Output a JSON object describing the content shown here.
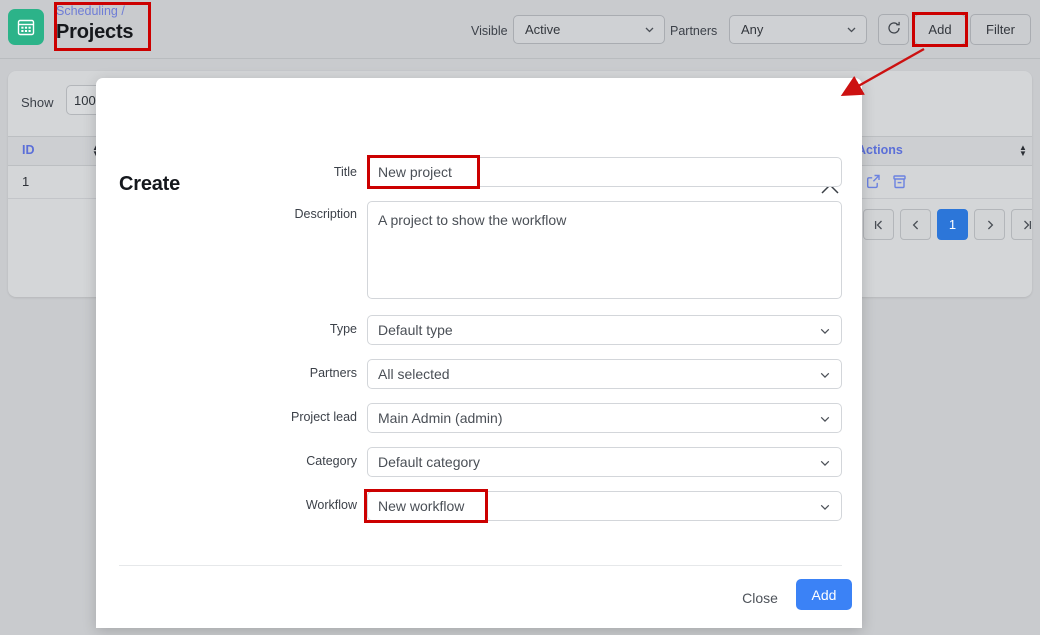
{
  "app": {
    "icon": "calendar-icon",
    "accent_green": "#2cb389",
    "accent_blue": "#3b82f6",
    "highlight_red": "#cc0000"
  },
  "header": {
    "breadcrumb": "Scheduling /",
    "title": "Projects"
  },
  "toolbar": {
    "visible_label": "Visible",
    "visible_value": "Active",
    "partners_label": "Partners",
    "partners_value": "Any",
    "refresh_icon": "refresh-icon",
    "add_label": "Add",
    "filter_label": "Filter"
  },
  "table": {
    "show_label": "Show",
    "show_value": "100",
    "search_placeholder": "",
    "search_value": "",
    "search_icon": "search-icon",
    "more_icon": "ellipsis-icon",
    "expand_icon": "collapse-arrow-icon",
    "columns": [
      {
        "label": "ID",
        "sortable": "true"
      },
      {
        "label": "Actions",
        "sortable": "true"
      }
    ],
    "rows": [
      {
        "id": "1",
        "actions": [
          "open-external-icon",
          "archive-icon"
        ]
      }
    ],
    "pagination": {
      "first": "|<",
      "prev": "<",
      "current": "1",
      "next": ">",
      "last": ">|"
    }
  },
  "modal": {
    "title": "Create",
    "close_icon": "close-icon",
    "fields": [
      {
        "label": "Title",
        "value": "New project",
        "kind": "input",
        "highlighted": true
      },
      {
        "label": "Description",
        "value": "A project to show the workflow",
        "kind": "textarea",
        "highlighted": false
      },
      {
        "label": "Type",
        "value": "Default type",
        "kind": "select",
        "highlighted": false
      },
      {
        "label": "Partners",
        "value": "All selected",
        "kind": "select",
        "highlighted": false
      },
      {
        "label": "Project lead",
        "value": "Main Admin (admin)",
        "kind": "select",
        "highlighted": false
      },
      {
        "label": "Category",
        "value": "Default category",
        "kind": "select",
        "highlighted": false
      },
      {
        "label": "Workflow",
        "value": "New workflow",
        "kind": "select",
        "highlighted": true
      }
    ],
    "close_label": "Close",
    "submit_label": "Add"
  }
}
